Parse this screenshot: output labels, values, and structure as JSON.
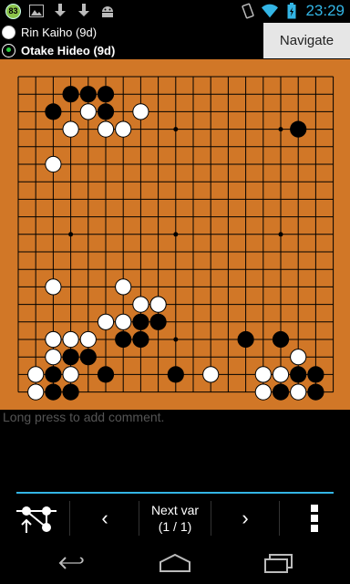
{
  "statusbar": {
    "notification_badge": "83",
    "icons": [
      "image-icon",
      "download-icon",
      "download-icon",
      "android-icon"
    ],
    "status_icons": [
      "vibrate-icon",
      "wifi-icon",
      "battery-icon"
    ],
    "time": "23:29",
    "accent_color": "#33b5e5"
  },
  "players": {
    "white": {
      "name": "Rin Kaiho (9d)",
      "stone": "white"
    },
    "black": {
      "name": "Otake Hideo (9d)",
      "stone": "black",
      "to_move": true
    }
  },
  "header": {
    "navigate_label": "Navigate"
  },
  "board": {
    "size": 19,
    "background_color": "#d17727",
    "star_points": [
      [
        3,
        3
      ],
      [
        9,
        3
      ],
      [
        15,
        3
      ],
      [
        3,
        9
      ],
      [
        9,
        9
      ],
      [
        15,
        9
      ],
      [
        3,
        15
      ],
      [
        9,
        15
      ],
      [
        15,
        15
      ]
    ],
    "black_stones": [
      [
        3,
        1
      ],
      [
        4,
        1
      ],
      [
        5,
        1
      ],
      [
        2,
        2
      ],
      [
        5,
        2
      ],
      [
        16,
        3
      ],
      [
        8,
        13
      ],
      [
        7,
        14
      ],
      [
        8,
        14
      ],
      [
        2,
        15
      ],
      [
        6,
        15
      ],
      [
        7,
        15
      ],
      [
        13,
        15
      ],
      [
        15,
        15
      ],
      [
        3,
        16
      ],
      [
        4,
        16
      ],
      [
        2,
        17
      ],
      [
        5,
        17
      ],
      [
        9,
        17
      ],
      [
        16,
        17
      ],
      [
        17,
        17
      ],
      [
        2,
        18
      ],
      [
        3,
        18
      ],
      [
        15,
        18
      ],
      [
        17,
        18
      ]
    ],
    "white_stones": [
      [
        4,
        2
      ],
      [
        7,
        2
      ],
      [
        3,
        3
      ],
      [
        5,
        3
      ],
      [
        6,
        3
      ],
      [
        2,
        5
      ],
      [
        2,
        12
      ],
      [
        6,
        12
      ],
      [
        7,
        13
      ],
      [
        8,
        13
      ],
      [
        5,
        14
      ],
      [
        6,
        14
      ],
      [
        2,
        15
      ],
      [
        3,
        15
      ],
      [
        4,
        15
      ],
      [
        2,
        16
      ],
      [
        16,
        16
      ],
      [
        1,
        17
      ],
      [
        3,
        17
      ],
      [
        11,
        17
      ],
      [
        14,
        17
      ],
      [
        15,
        17
      ],
      [
        1,
        18
      ],
      [
        14,
        18
      ],
      [
        16,
        18
      ]
    ]
  },
  "comment": {
    "placeholder": "Long press to add comment."
  },
  "toolbar": {
    "next_var_label": "Next var",
    "next_var_count": "(1 / 1)",
    "prev_icon": "chevron-left-icon",
    "next_icon": "chevron-right-icon",
    "tree_icon": "game-tree-icon",
    "menu_icon": "overflow-menu-icon"
  },
  "navbar": {
    "icons": [
      "back-icon",
      "home-icon",
      "recent-apps-icon"
    ]
  }
}
